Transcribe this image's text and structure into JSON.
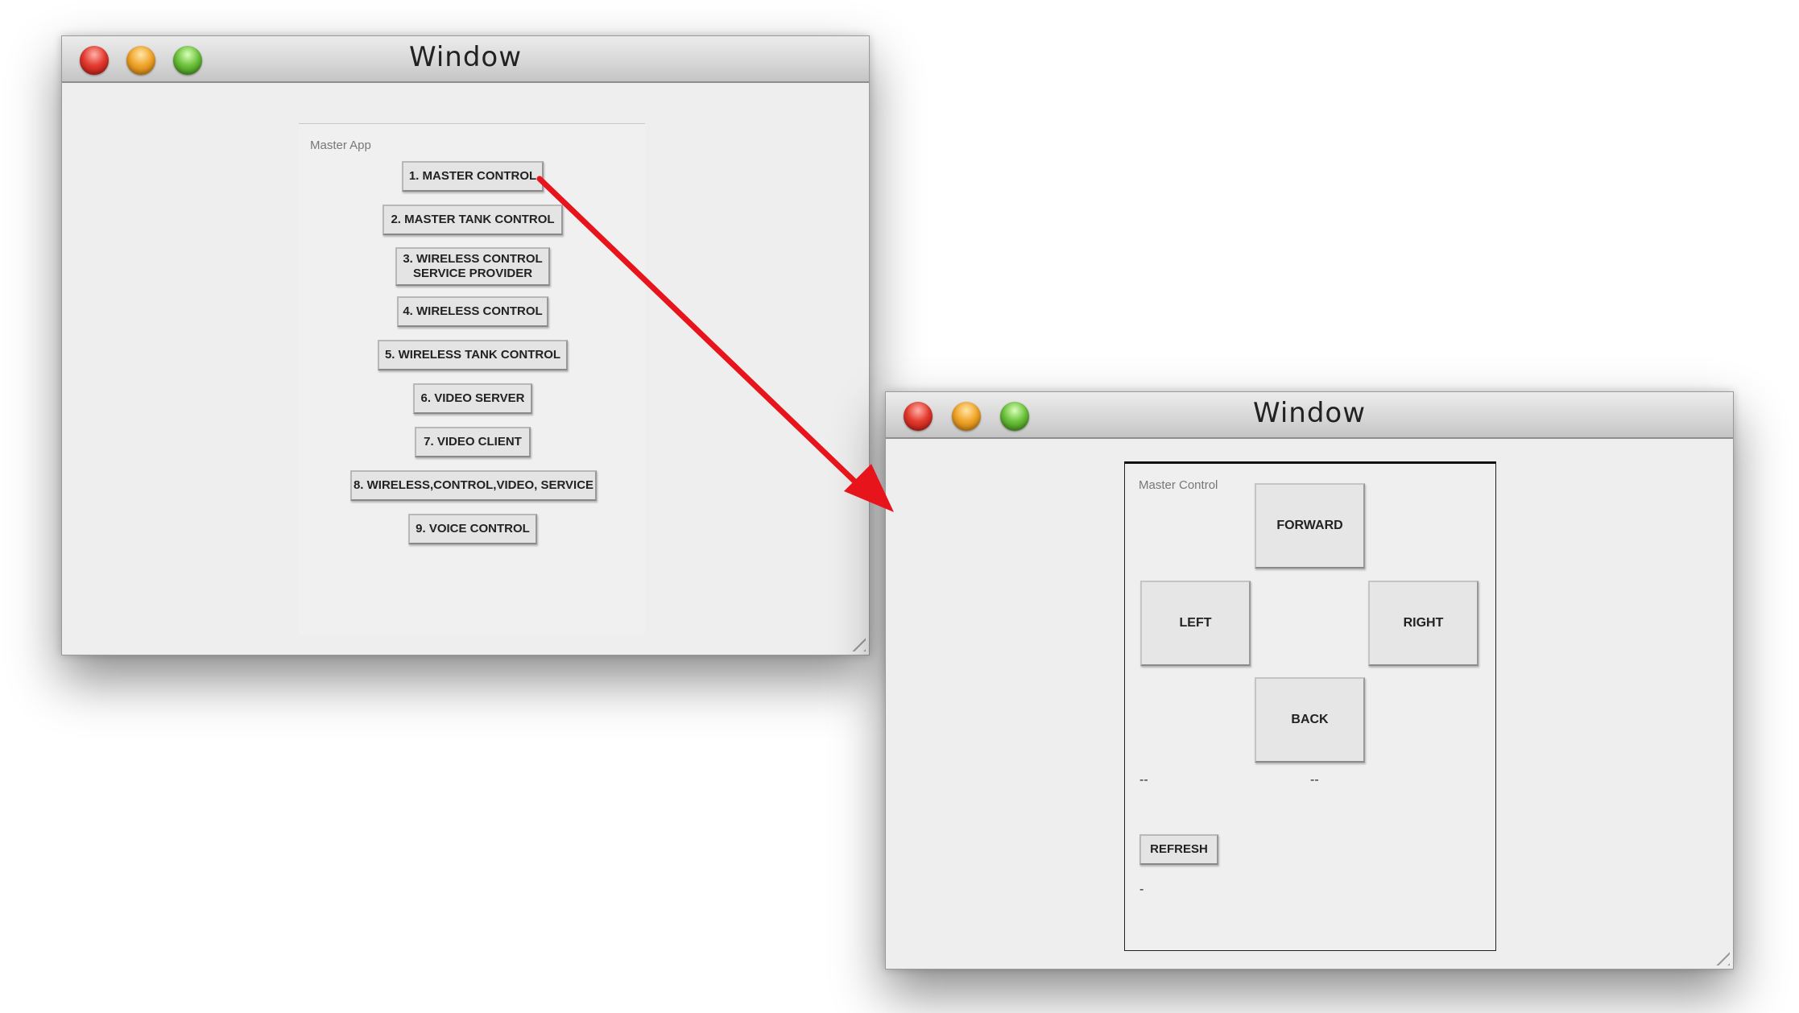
{
  "window1": {
    "title": "Window",
    "panel_label": "Master App",
    "buttons": [
      "1. MASTER CONTROL",
      "2. MASTER TANK CONTROL",
      "3. WIRELESS CONTROL\nSERVICE PROVIDER",
      "4. WIRELESS CONTROL",
      "5. WIRELESS TANK CONTROL",
      "6. VIDEO SERVER",
      "7. VIDEO CLIENT",
      "8. WIRELESS,CONTROL,VIDEO, SERVICE",
      "9. VOICE CONTROL"
    ]
  },
  "window2": {
    "title": "Window",
    "panel_label": "Master Control",
    "forward_label": "FORWARD",
    "left_label": "LEFT",
    "right_label": "RIGHT",
    "back_label": "BACK",
    "status_left": "--",
    "status_right": "--",
    "refresh_label": "REFRESH",
    "result_text": "-"
  },
  "colors": {
    "arrow": "#e8141c",
    "window_bg": "#eeeeee"
  }
}
